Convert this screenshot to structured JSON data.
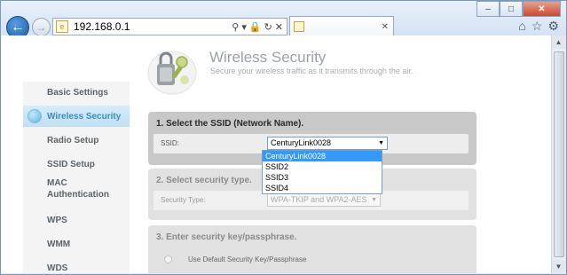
{
  "browser": {
    "url": "192.168.0.1",
    "tab_title": ""
  },
  "header": {
    "title": "Wireless Security",
    "subtitle": "Secure your wireless traffic as it transmits through the air."
  },
  "sidebar": {
    "items": [
      {
        "label": "Basic Settings",
        "active": false
      },
      {
        "label": "Wireless Security",
        "active": true
      },
      {
        "label": "Radio Setup",
        "active": false
      },
      {
        "label": "SSID Setup",
        "active": false
      },
      {
        "label": "MAC Authentication",
        "active": false
      },
      {
        "label": "WPS",
        "active": false
      },
      {
        "label": "WMM",
        "active": false
      },
      {
        "label": "WDS",
        "active": false
      }
    ]
  },
  "section1": {
    "title": "1. Select the SSID (Network Name).",
    "label": "SSID:",
    "value": "CenturyLink0028",
    "options": [
      "CenturyLink0028",
      "SSID2",
      "SSID3",
      "SSID4"
    ]
  },
  "section2": {
    "title": "2. Select security type.",
    "label": "Security Type:",
    "value": "WPA-TKIP and WPA2-AES"
  },
  "section3": {
    "title": "3. Enter security key/passphrase.",
    "radio_label": "Use Default Security Key/Passphrase"
  },
  "colors": {
    "accent": "#3a8cc0",
    "selected_option": "#3399ff"
  }
}
